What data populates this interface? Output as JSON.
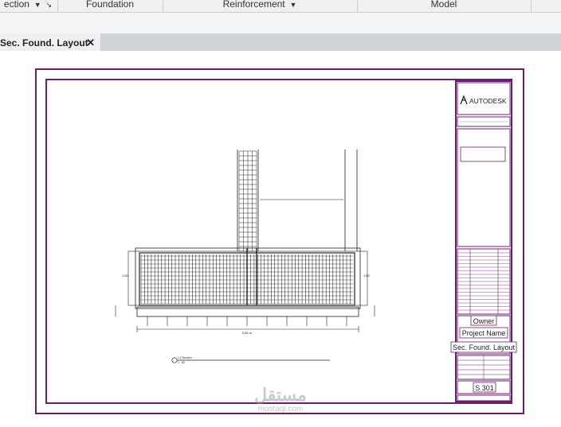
{
  "ribbon": {
    "groups": [
      {
        "label": "ection",
        "dropdown": true,
        "launcher": true
      },
      {
        "label": "Foundation",
        "dropdown": false
      },
      {
        "label": "Reinforcement",
        "dropdown": true
      },
      {
        "label": "Model",
        "dropdown": false
      }
    ]
  },
  "tab": {
    "label": "Sec. Found. Layout",
    "close": "✕"
  },
  "title_block": {
    "logo": "AUTODESK",
    "owner": "Owner",
    "project_name": "Project Name",
    "sheet_name": "Sec. Found. Layout",
    "sheet_number": "S 301"
  },
  "drawing": {
    "dim_bottom": "5.80 m",
    "dim_left": "1.60",
    "dim_right": "1.60",
    "section_tag": "1.2 Section",
    "section_scale": "1 : 50"
  },
  "watermark": {
    "brand": "مستقل",
    "site": "mostaql.com"
  },
  "colors": {
    "sheet_border": "#6b1f6b",
    "ribbon_bg": "#eef0f2",
    "tab_bar": "#cfd2d6"
  }
}
